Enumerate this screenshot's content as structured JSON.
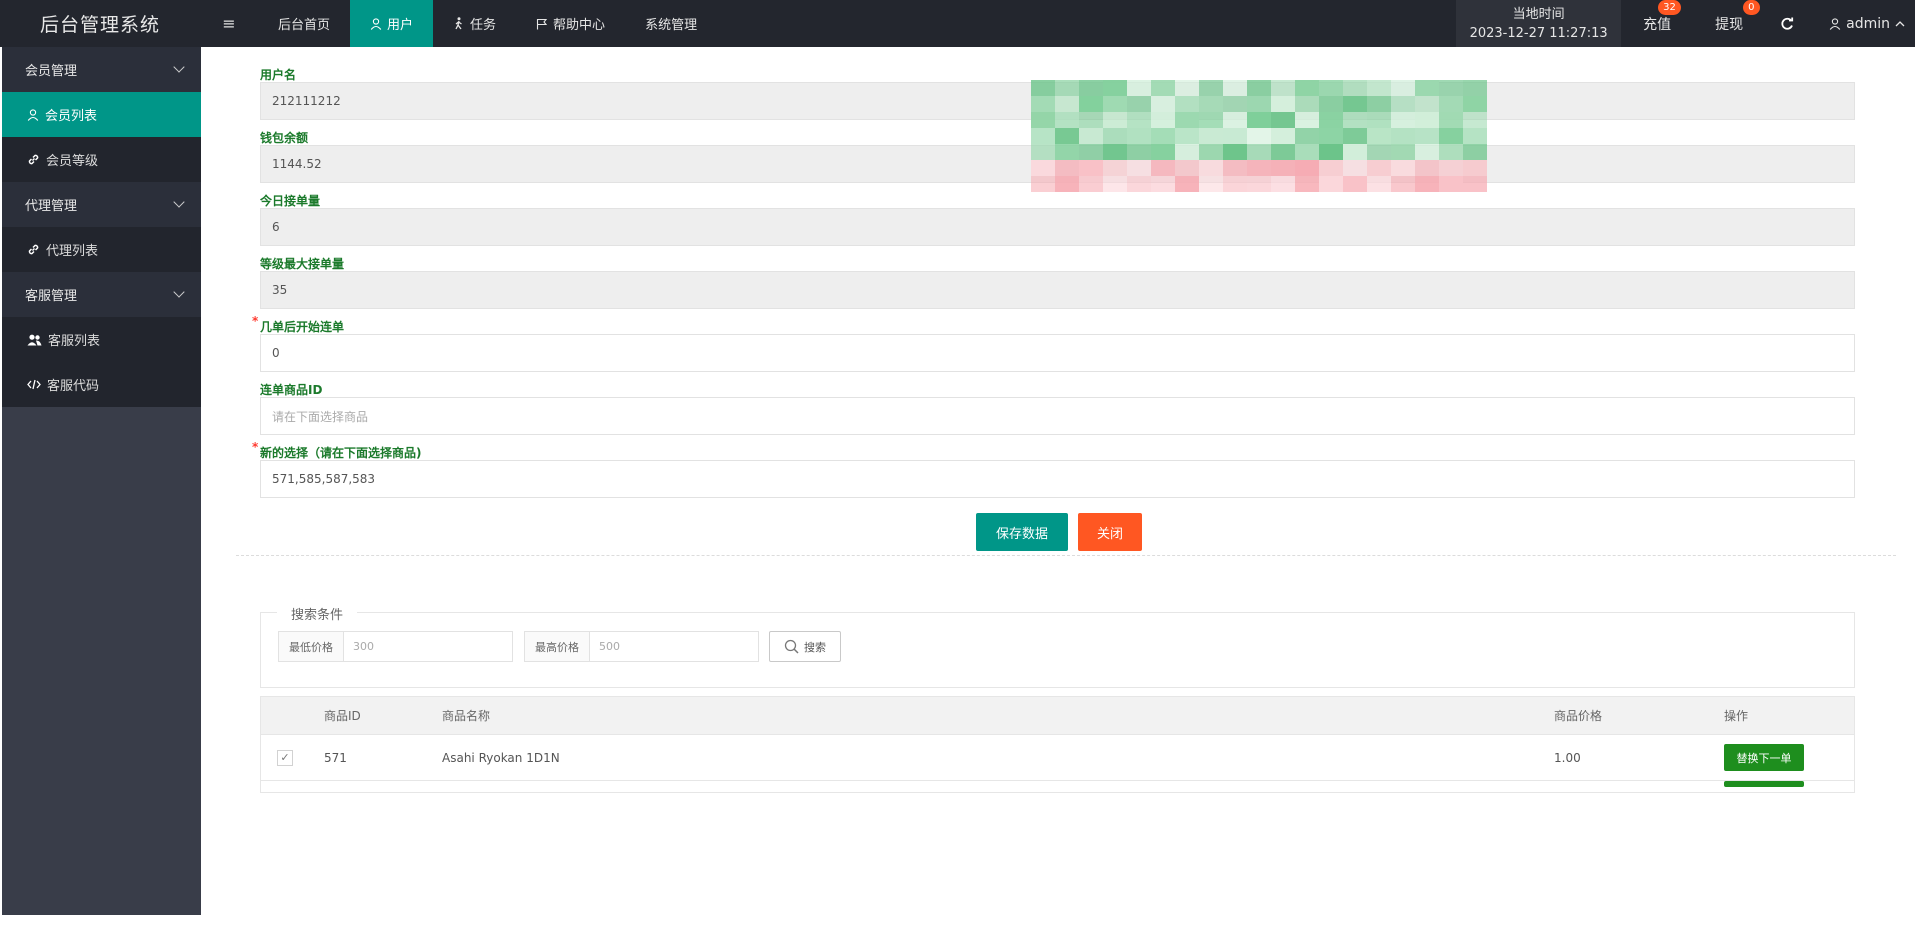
{
  "header": {
    "brand": "后台管理系统",
    "toggle_icon": "≡",
    "nav": [
      {
        "label": "后台首页",
        "icon": ""
      },
      {
        "label": "用户",
        "icon": "user-icon"
      },
      {
        "label": "任务",
        "icon": "walk-icon"
      },
      {
        "label": "帮助中心",
        "icon": "flag-icon"
      },
      {
        "label": "系统管理",
        "icon": ""
      }
    ],
    "time_label": "当地时间",
    "time_value": "2023-12-27 11:27:13",
    "recharge_label": "充值",
    "recharge_badge": "32",
    "withdraw_label": "提现",
    "withdraw_badge": "0",
    "user": "admin"
  },
  "sidebar": {
    "groups": [
      {
        "label": "会员管理",
        "items": [
          {
            "label": "会员列表",
            "active": true
          },
          {
            "label": "会员等级"
          }
        ]
      },
      {
        "label": "代理管理",
        "items": [
          {
            "label": "代理列表"
          }
        ]
      },
      {
        "label": "客服管理",
        "items": [
          {
            "label": "客服列表"
          },
          {
            "label": "客服代码"
          }
        ]
      }
    ]
  },
  "form": {
    "username_label": "用户名",
    "username_value": "212111212",
    "balance_label": "钱包余额",
    "balance_value": "1144.52",
    "today_orders_label": "今日接单量",
    "today_orders_value": "6",
    "max_orders_label": "等级最大接单量",
    "max_orders_value": "35",
    "start_after_label": "几单后开始连单",
    "start_after_value": "0",
    "product_id_label": "连单商品ID",
    "product_id_placeholder": "请在下面选择商品",
    "new_selection_label": "新的选择（请在下面选择商品)",
    "new_selection_value": "571,585,587,583",
    "save_button": "保存数据",
    "close_button": "关闭"
  },
  "search": {
    "legend": "搜索条件",
    "min_label": "最低价格",
    "min_placeholder": "300",
    "max_label": "最高价格",
    "max_placeholder": "500",
    "button": "搜索"
  },
  "table": {
    "headers": [
      "商品ID",
      "商品名称",
      "商品价格",
      "操作"
    ],
    "rows": [
      {
        "checked": "✓",
        "id": "571",
        "name": "Asahi Ryokan 1D1N",
        "price": "1.00",
        "action": "替换下一单"
      }
    ]
  },
  "colors": {
    "accent": "#009688",
    "danger": "#ff5722",
    "topbar": "#23262e",
    "sidebar": "#393d49",
    "label_green": "#1b7a2b"
  }
}
